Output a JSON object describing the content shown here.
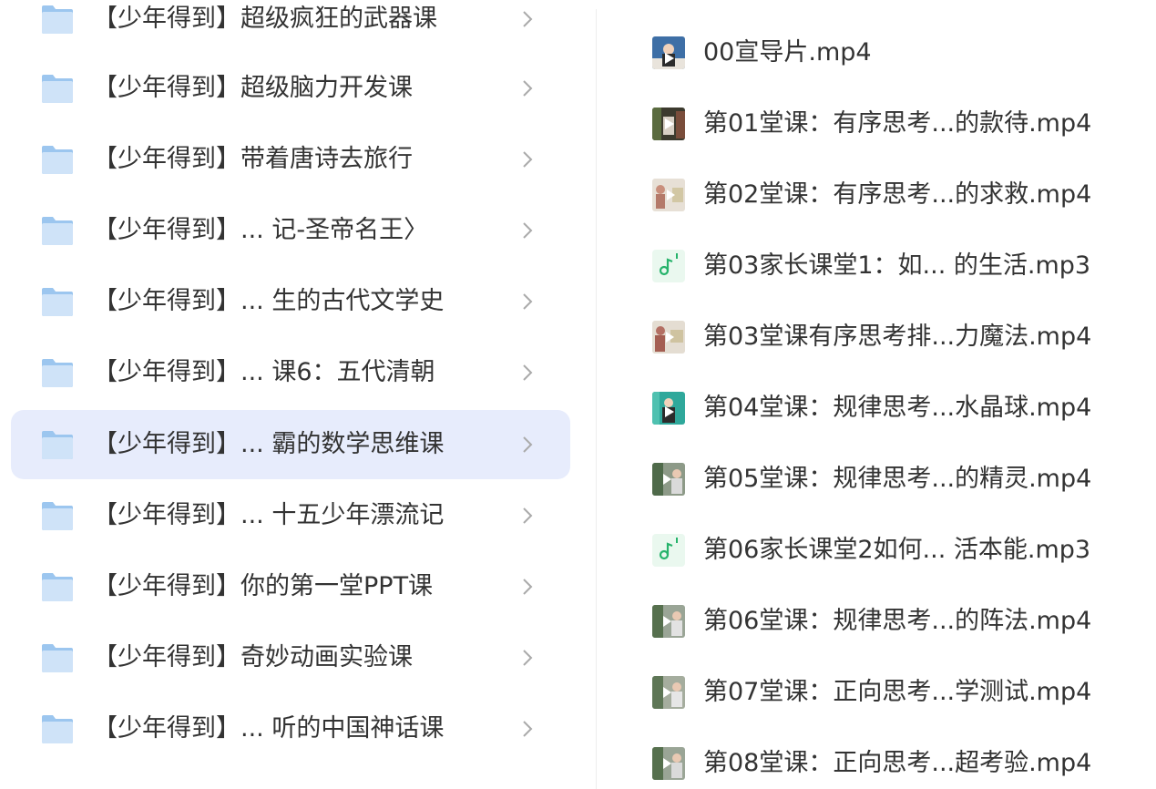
{
  "folders": [
    {
      "label": "【少年得到】超级疯狂的武器课",
      "selected": false
    },
    {
      "label": "【少年得到】超级脑力开发课",
      "selected": false
    },
    {
      "label": "【少年得到】带着唐诗去旅行",
      "selected": false
    },
    {
      "label": "【少年得到】...  记-圣帝名王〉",
      "selected": false
    },
    {
      "label": "【少年得到】... 生的古代文学史",
      "selected": false
    },
    {
      "label": "【少年得到】...  课6：五代清朝",
      "selected": false
    },
    {
      "label": "【少年得到】... 霸的数学思维课",
      "selected": true
    },
    {
      "label": "【少年得到】... 十五少年漂流记",
      "selected": false
    },
    {
      "label": "【少年得到】你的第一堂PPT课",
      "selected": false
    },
    {
      "label": "【少年得到】奇妙动画实验课",
      "selected": false
    },
    {
      "label": "【少年得到】... 听的中国神话课",
      "selected": false
    }
  ],
  "files": [
    {
      "label": "00宣导片.mp4",
      "type": "video",
      "icon": "video-thumbnail-icon"
    },
    {
      "label": "第01堂课：有序思考...的款待.mp4",
      "type": "video",
      "icon": "video-thumbnail-icon"
    },
    {
      "label": "第02堂课：有序思考...的求救.mp4",
      "type": "video",
      "icon": "video-thumbnail-icon"
    },
    {
      "label": "第03家长课堂1：如...  的生活.mp3",
      "type": "audio",
      "icon": "music-note-icon"
    },
    {
      "label": "第03堂课有序思考排...力魔法.mp4",
      "type": "video",
      "icon": "video-thumbnail-icon"
    },
    {
      "label": "第04堂课：规律思考...水晶球.mp4",
      "type": "video",
      "icon": "video-thumbnail-icon"
    },
    {
      "label": "第05堂课：规律思考...的精灵.mp4",
      "type": "video",
      "icon": "video-thumbnail-icon"
    },
    {
      "label": "第06家长课堂2如何...  活本能.mp3",
      "type": "audio",
      "icon": "music-note-icon"
    },
    {
      "label": "第06堂课：规律思考...的阵法.mp4",
      "type": "video",
      "icon": "video-thumbnail-icon"
    },
    {
      "label": "第07堂课：正向思考...学测试.mp4",
      "type": "video",
      "icon": "video-thumbnail-icon"
    },
    {
      "label": "第08堂课：正向思考...超考验.mp4",
      "type": "video",
      "icon": "video-thumbnail-icon"
    }
  ],
  "colors": {
    "folder_light": "#cfe3f8",
    "folder_dark": "#9cc6ef",
    "selected_bg": "#e7ecfc",
    "audio_green": "#26b36b",
    "text": "#333333",
    "chevron": "#aaaaaa"
  }
}
